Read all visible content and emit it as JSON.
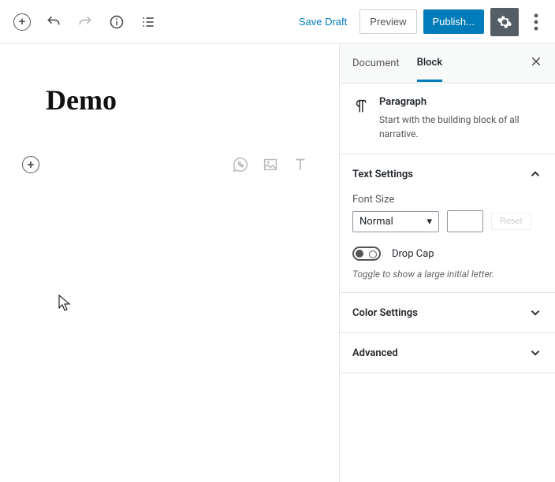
{
  "toolbar": {
    "save_draft": "Save Draft",
    "preview": "Preview",
    "publish": "Publish..."
  },
  "title": "Demo",
  "sidebar": {
    "tabs": {
      "document": "Document",
      "block": "Block"
    },
    "block_info": {
      "name": "Paragraph",
      "description": "Start with the building block of all narrative."
    },
    "text_settings": {
      "title": "Text Settings",
      "font_size_label": "Font Size",
      "font_size_value": "Normal",
      "reset": "Reset",
      "drop_cap": "Drop Cap",
      "drop_cap_help": "Toggle to show a large initial letter."
    },
    "color_settings": {
      "title": "Color Settings"
    },
    "advanced": {
      "title": "Advanced"
    }
  }
}
